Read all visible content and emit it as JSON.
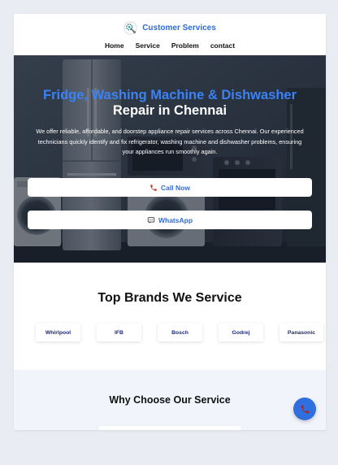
{
  "header": {
    "brand_name": "Customer Services",
    "logo_icon": "gear-wrench-logo-icon",
    "nav": [
      "Home",
      "Service",
      "Problem",
      "contact"
    ]
  },
  "hero": {
    "title_line1": "Fridge, Washing Machine & Dishwasher",
    "title_line2": "Repair in Chennai",
    "description": "We offer reliable, affordable, and doorstep appliance repair services across Chennai. Our experienced technicians quickly identify and fix refrigerator, washing machine and dishwasher problems, ensuring your appliances run smoothly again.",
    "call_button": "Call Now",
    "call_icon": "phone-icon",
    "whatsapp_button": "WhatsApp",
    "whatsapp_icon": "chat-bubble-icon"
  },
  "brands": {
    "title": "Top Brands We Service",
    "items": [
      "Whirlpool",
      "IFB",
      "Bosch",
      "Godrej",
      "Panasonic"
    ]
  },
  "why": {
    "title": "Why Choose Our Service"
  },
  "floating_call": {
    "icon": "phone-icon"
  },
  "colors": {
    "accent_blue": "#2f6bd8",
    "hero_title_blue": "#3b82f6",
    "fab_blue": "#2f6fe0",
    "phone_red": "#c0392b",
    "brand_text": "#1e2a78",
    "section_bg": "#f1f5fb",
    "page_bg": "#e9ecf3"
  }
}
